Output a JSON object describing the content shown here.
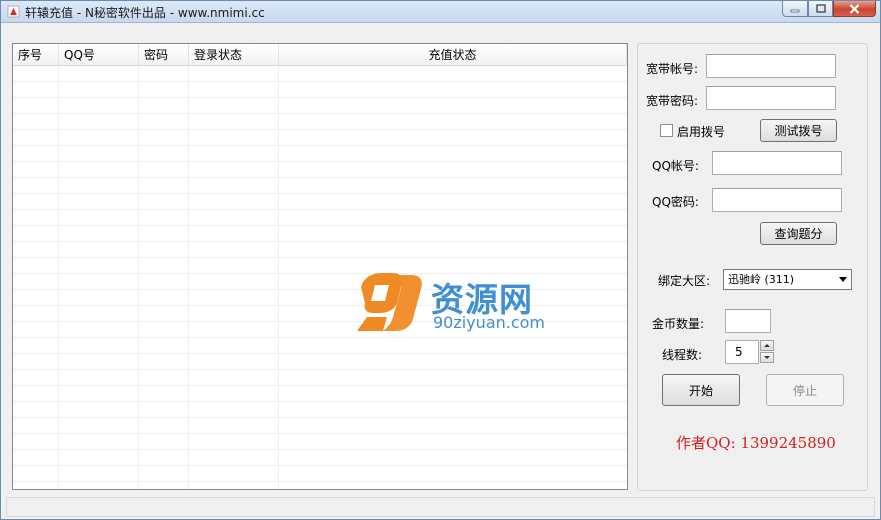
{
  "window": {
    "title": "轩辕充值 - N秘密软件出品 - www.nmimi.cc"
  },
  "list": {
    "columns": [
      {
        "label": "序号"
      },
      {
        "label": "QQ号"
      },
      {
        "label": "密码"
      },
      {
        "label": "登录状态"
      },
      {
        "label": "充值状态"
      }
    ]
  },
  "watermark": {
    "title": "资源网",
    "url": "90ziyuan.com"
  },
  "form": {
    "broadband_account_label": "宽带帐号:",
    "broadband_account_value": "",
    "broadband_password_label": "宽带密码:",
    "broadband_password_value": "",
    "enable_dial_label": "启用拨号",
    "enable_dial_checked": false,
    "test_dial_label": "测试拨号",
    "qq_account_label": "QQ帐号:",
    "qq_account_value": "",
    "qq_password_label": "QQ密码:",
    "qq_password_value": "",
    "query_points_label": "查询题分",
    "bind_server_label": "绑定大区:",
    "bind_server_value": "迅驰岭 (311)",
    "coins_label": "金币数量:",
    "coins_value": "",
    "threads_label": "线程数:",
    "threads_value": "5",
    "start_label": "开始",
    "stop_label": "停止",
    "author": "作者QQ: 1399245890"
  },
  "colors": {
    "author_text": "#d81e1e",
    "watermark": "#3f8fd2"
  }
}
